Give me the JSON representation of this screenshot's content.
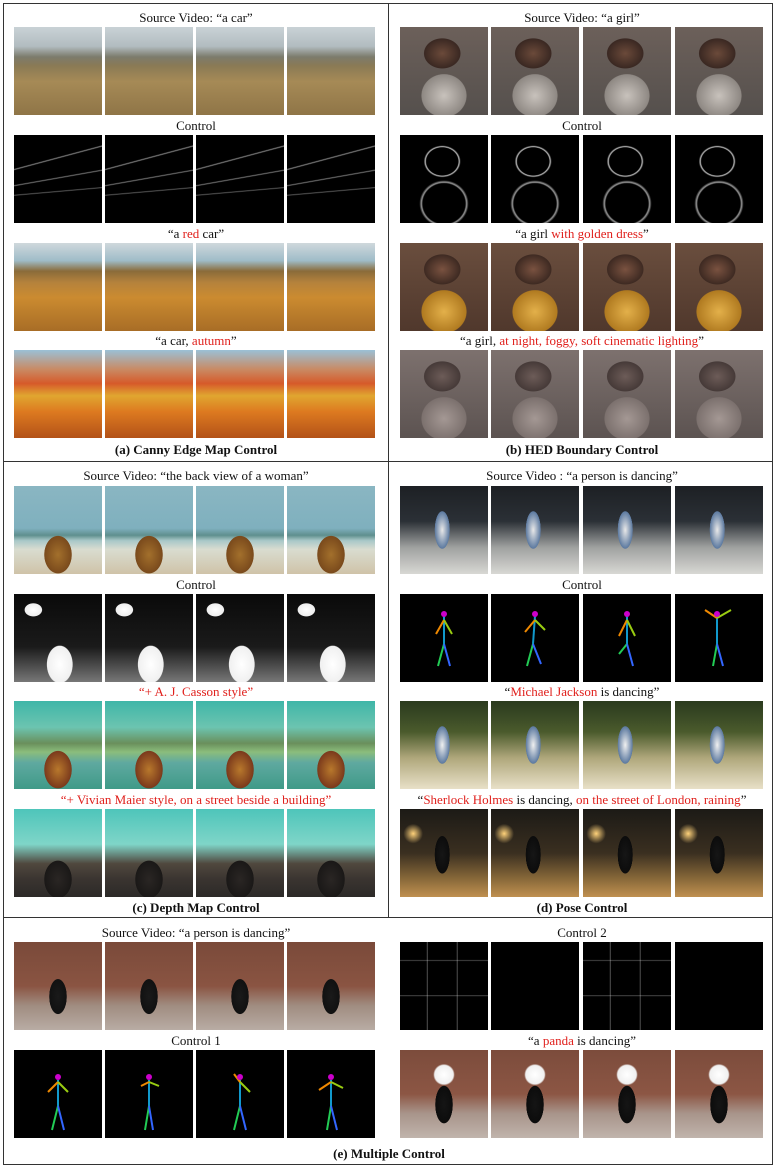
{
  "panels": {
    "a": {
      "source_caption": "Source Video: “a car”",
      "control_caption": "Control",
      "prompt1": {
        "open": "“a ",
        "highlight": "red",
        "close": " car”"
      },
      "prompt2": {
        "open": "“a car, ",
        "highlight": "autumn",
        "close": "”"
      },
      "title": "(a) Canny Edge Map Control"
    },
    "b": {
      "source_caption": "Source Video: “a girl”",
      "control_caption": "Control",
      "prompt1": {
        "open": "“a girl ",
        "highlight": "with golden dress",
        "close": "”"
      },
      "prompt2": {
        "open": "“a girl, ",
        "highlight": "at night, foggy, soft cinematic lighting",
        "close": "”"
      },
      "title": "(b) HED Boundary Control"
    },
    "c": {
      "source_caption": "Source Video: “the back view of a woman”",
      "control_caption": "Control",
      "prompt1": {
        "open": "“+ ",
        "highlight": "A. J. Casson style",
        "close": "”"
      },
      "prompt2": {
        "open": "“+ ",
        "highlight": "Vivian Maier style, on a street beside a building",
        "close": "”"
      },
      "title": "(c) Depth Map Control"
    },
    "d": {
      "source_caption": "Source Video : “a person is dancing”",
      "control_caption": "Control",
      "prompt1": {
        "open": "“",
        "highlight": "Michael Jackson",
        "close": " is dancing”"
      },
      "prompt2": {
        "open": "“",
        "highlight": "Sherlock Holmes",
        "middle": " is dancing, ",
        "highlight2": "on the street of London, raining",
        "close": "”"
      },
      "title": "(d) Pose Control"
    },
    "e": {
      "source_caption": "Source Video: “a person is dancing”",
      "control1_caption": "Control 1",
      "control2_caption": "Control 2",
      "prompt": {
        "open": "“a ",
        "highlight": "panda",
        "close": " is dancing”"
      },
      "title": "(e) Multiple Control"
    }
  },
  "colors": {
    "highlight": "#e0201c",
    "border": "#333333"
  }
}
